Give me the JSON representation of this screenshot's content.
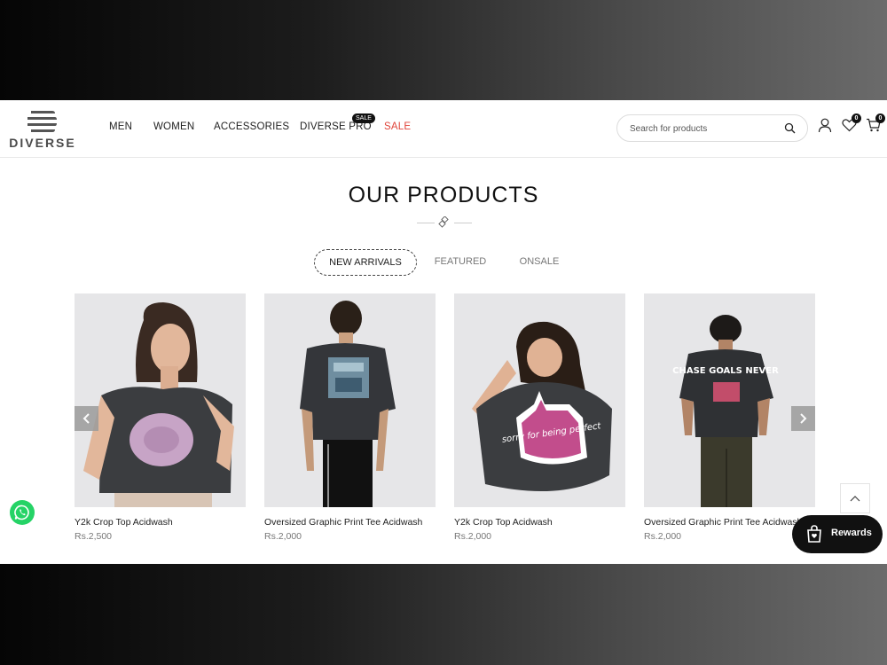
{
  "brand": {
    "name": "DIVERSE"
  },
  "nav": {
    "items": [
      {
        "label": "MEN"
      },
      {
        "label": "WOMEN"
      },
      {
        "label": "ACCESSORIES"
      },
      {
        "label": "DIVERSE PRO",
        "badge": "SALE"
      },
      {
        "label": "SALE"
      }
    ]
  },
  "search": {
    "placeholder": "Search for products",
    "value": ""
  },
  "header_icons": {
    "wishlist_count": "0",
    "cart_count": "0"
  },
  "section": {
    "title": "OUR PRODUCTS",
    "tabs": [
      {
        "label": "NEW ARRIVALS",
        "active": true
      },
      {
        "label": "FEATURED",
        "active": false
      },
      {
        "label": "ONSALE",
        "active": false
      }
    ]
  },
  "products": [
    {
      "name": "Y2k Crop Top Acidwash",
      "price": "Rs.2,500"
    },
    {
      "name": "Oversized Graphic Print Tee Acidwash",
      "price": "Rs.2,000"
    },
    {
      "name": "Y2k Crop Top Acidwash",
      "price": "Rs.2,000"
    },
    {
      "name": "Oversized Graphic Print Tee Acidwash",
      "price": "Rs.2,000"
    }
  ],
  "product_art": [
    {
      "print_text": ""
    },
    {
      "print_text": ""
    },
    {
      "print_text": "sorry for being perfect"
    },
    {
      "print_text": "CHASE GOALS NEVER"
    }
  ],
  "rewards": {
    "label": "Rewards"
  },
  "colors": {
    "accent": "#e0443a",
    "dark": "#111111",
    "whatsapp": "#25d366"
  },
  "icons": [
    "logo-icon",
    "search-icon",
    "user-icon",
    "heart-icon",
    "cart-icon",
    "chevron-left-icon",
    "chevron-right-icon",
    "chevron-up-icon",
    "shopping-bag-icon",
    "whatsapp-icon",
    "diamond-ornament-icon"
  ]
}
